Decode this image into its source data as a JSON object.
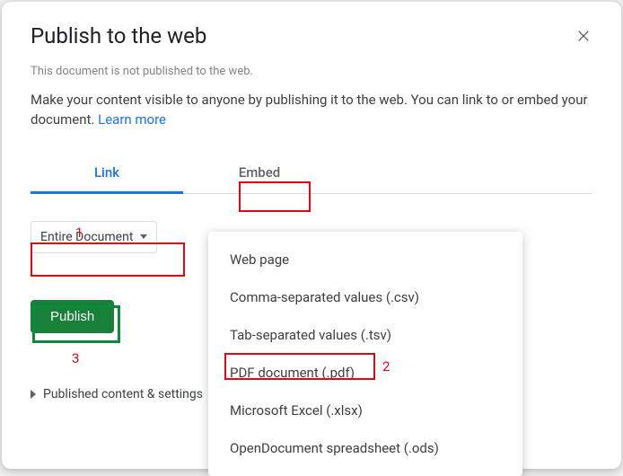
{
  "dialog": {
    "title": "Publish to the web",
    "status": "This document is not published to the web.",
    "description": "Make your content visible to anyone by publishing it to the web. You can link to or embed your document. ",
    "learn_more": "Learn more"
  },
  "tabs": {
    "link": "Link",
    "embed": "Embed"
  },
  "select": {
    "value": "Entire Document"
  },
  "format_menu": {
    "items": [
      "Web page",
      "Comma-separated values (.csv)",
      "Tab-separated values (.tsv)",
      "PDF document (.pdf)",
      "Microsoft Excel (.xlsx)",
      "OpenDocument spreadsheet (.ods)"
    ]
  },
  "buttons": {
    "publish": "Publish"
  },
  "collapsible": {
    "published_content": "Published content & settings"
  },
  "annotations": {
    "n1": "1",
    "n2": "2",
    "n3": "3"
  }
}
